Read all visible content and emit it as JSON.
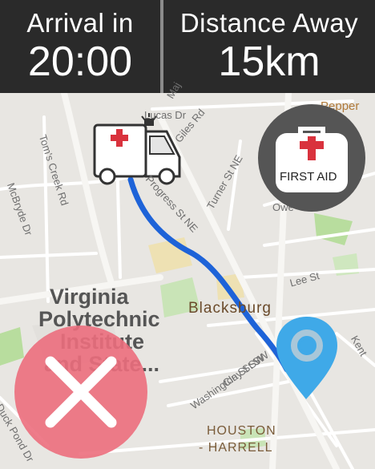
{
  "header": {
    "arrival_label": "Arrival in",
    "arrival_value": "20:00",
    "distance_label": "Distance Away",
    "distance_value": "15km"
  },
  "map": {
    "street_labels": [
      "Lucas Dr",
      "Giles Rd",
      "Progress St NE",
      "Turner St NE",
      "Tom's Creek Rd",
      "McBryde Dr",
      "Lee St",
      "Washington St SW",
      "Clay St SW",
      "Duck Pond Dr",
      "Kent",
      "Owe",
      "Maj",
      "Pepper"
    ],
    "city": "Blacksburg",
    "poi": [
      "Virginia",
      "Polytechnic",
      "Institute",
      "and State..."
    ],
    "neighborhood": [
      "HOUSTON",
      "- HARRELL"
    ],
    "route_color": "#1e63d8",
    "destination_color": "#3fa9e8"
  },
  "first_aid": {
    "label": "FIRST AID"
  },
  "colors": {
    "header_bg": "#2a2a2a",
    "close_button": "#ec6e7d",
    "cross": "#d9323d"
  }
}
